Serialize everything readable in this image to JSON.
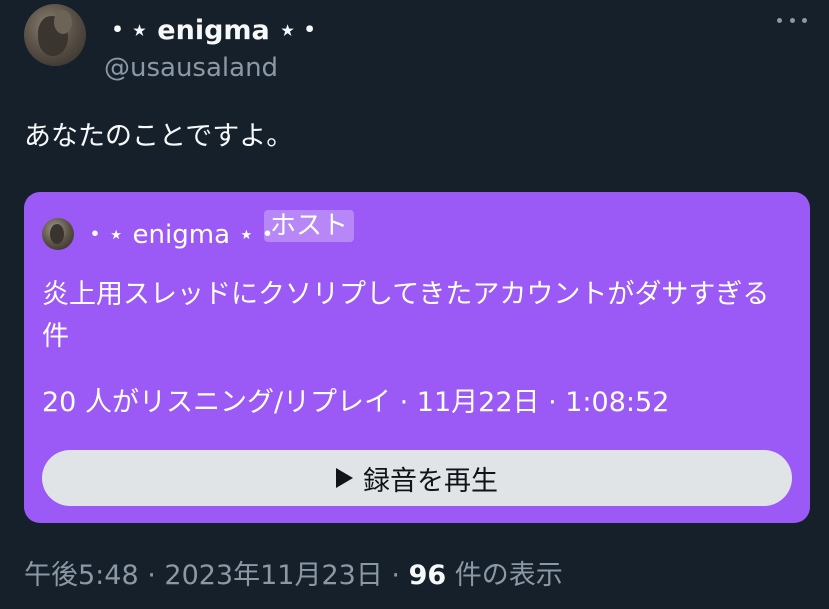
{
  "author": {
    "display_name": "・⋆ enigma ⋆・",
    "handle": "@usausaland"
  },
  "more_icon": "more-horizontal-icon",
  "tweet": {
    "text": "あなたのことですよ。"
  },
  "space": {
    "host_name": "・⋆ enigma ⋆・",
    "host_badge": "ホスト",
    "title": "炎上用スレッドにクソリプしてきたアカウントがダサすぎる件",
    "meta": "20 人がリスニング/リプレイ · 11月22日 · 1:08:52",
    "play_label": "録音を再生",
    "card_color": "#9b59f5"
  },
  "footer": {
    "time": "午後5:48",
    "separator1": " · ",
    "date": "2023年11月23日",
    "separator2": " · ",
    "views_count": "96",
    "views_label": " 件の表示"
  }
}
